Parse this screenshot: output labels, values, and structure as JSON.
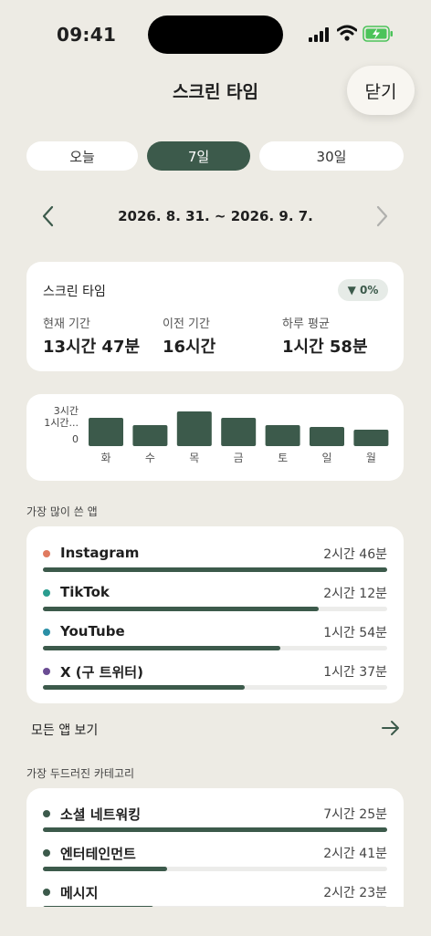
{
  "status_bar": {
    "time": "09:41"
  },
  "header": {
    "title": "스크린 타임",
    "close_label": "닫기"
  },
  "tabs": [
    {
      "label": "오늘",
      "selected": false
    },
    {
      "label": "7일",
      "selected": true
    },
    {
      "label": "30일",
      "selected": false
    }
  ],
  "date_range": "2026. 8. 31. ~ 2026. 9. 7.",
  "summary": {
    "title": "스크린 타임",
    "change_badge": "▼ 0%",
    "stats": [
      {
        "label": "현재 기간",
        "value": "13시간 47분"
      },
      {
        "label": "이전 기간",
        "value": "16시간"
      },
      {
        "label": "하루 평균",
        "value": "1시간 58분"
      }
    ]
  },
  "chart_data": {
    "type": "bar",
    "categories": [
      "화",
      "수",
      "목",
      "금",
      "토",
      "일",
      "월"
    ],
    "values": [
      31,
      23,
      38,
      31,
      23,
      21,
      18
    ],
    "value_unit": "minutes",
    "y_tick_labels": [
      "3시간",
      "1시간...",
      "0"
    ],
    "bar_color": "#3c5a4b"
  },
  "top_apps": {
    "section_label": "가장 많이 쓴 앱",
    "items": [
      {
        "name": "Instagram",
        "duration": "2시간 46분",
        "share": 1.0,
        "dot_color": "#e07a5f"
      },
      {
        "name": "TikTok",
        "duration": "2시간 12분",
        "share": 0.8,
        "dot_color": "#2a9d8f"
      },
      {
        "name": "YouTube",
        "duration": "1시간 54분",
        "share": 0.69,
        "dot_color": "#2a8fa6"
      },
      {
        "name": "X (구 트위터)",
        "duration": "1시간 37분",
        "share": 0.585,
        "dot_color": "#6a4c93"
      }
    ],
    "see_all_label": "모든 앱 보기"
  },
  "categories": {
    "section_label": "가장 두드러진 카테고리",
    "items": [
      {
        "name": "소셜 네트워킹",
        "duration": "7시간 25분",
        "share": 1.0,
        "dot_color": "#3c5a4b"
      },
      {
        "name": "엔터테인먼트",
        "duration": "2시간 41분",
        "share": 0.36,
        "dot_color": "#3c5a4b"
      },
      {
        "name": "메시지",
        "duration": "2시간 23분",
        "share": 0.32,
        "dot_color": "#3c5a4b"
      }
    ]
  },
  "colors": {
    "accent": "#3c5a4b",
    "background": "#edebe4",
    "card": "#ffffff"
  },
  "icons": [
    "signal-icon",
    "wifi-icon",
    "battery-charging-icon",
    "chevron-left-icon",
    "chevron-right-icon",
    "arrow-right-icon"
  ]
}
